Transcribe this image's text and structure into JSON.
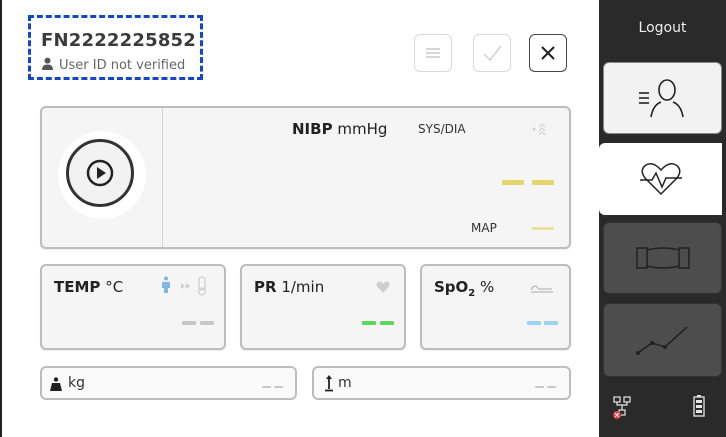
{
  "patient": {
    "id": "FN2222225852",
    "user_status": "User ID not verified"
  },
  "nibp": {
    "name": "NIBP",
    "unit": "mmHg",
    "sys_dia_label": "SYS/DIA",
    "map_label": "MAP",
    "color": "#e8d56a"
  },
  "temp": {
    "name": "TEMP",
    "unit": "°C",
    "color": "#c7c7c7"
  },
  "pr": {
    "name": "PR",
    "unit": "1/min",
    "color": "#5cd65c"
  },
  "spo2": {
    "name": "SpO",
    "sub": "2",
    "unit": "%",
    "color": "#9ed3ee"
  },
  "weight": {
    "unit": "kg"
  },
  "height": {
    "unit": "m"
  },
  "sidebar": {
    "logout_label": "Logout"
  },
  "icons": {
    "play": "play-icon",
    "list": "list-icon",
    "check": "check-icon",
    "close": "close-icon",
    "patient": "patient-list-icon",
    "vitals": "heart-monitor-icon",
    "cuff": "cuff-icon",
    "trend": "trend-icon",
    "network": "network-error-icon",
    "battery": "battery-icon"
  }
}
